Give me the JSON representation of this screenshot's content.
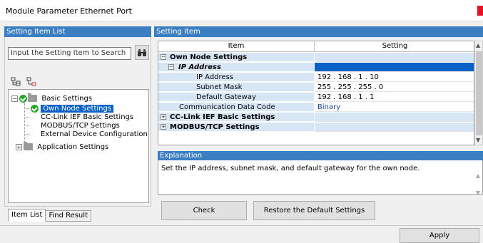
{
  "window": {
    "title": "Module Parameter Ethernet Port"
  },
  "left_panel": {
    "header": "Setting Item List",
    "search_placeholder": "Input the Setting Item to Search",
    "tree": [
      {
        "label": "Basic Settings"
      },
      {
        "label": "Own Node Settings"
      },
      {
        "label": "CC-Link IEF Basic Settings"
      },
      {
        "label": "MODBUS/TCP Settings"
      },
      {
        "label": "External Device Configuration"
      },
      {
        "label": "Application Settings"
      }
    ],
    "tabs": [
      "Item List",
      "Find Result"
    ]
  },
  "right_panel": {
    "header": "Setting Item",
    "columns": [
      "Item",
      "Setting"
    ],
    "rows": [
      {
        "item": "Own Node Settings",
        "setting": ""
      },
      {
        "item": "IP Address",
        "setting": ""
      },
      {
        "item": "IP Address",
        "setting": "192 . 168 .   1 .  10"
      },
      {
        "item": "Subnet Mask",
        "setting": "255 . 255 . 255 .   0"
      },
      {
        "item": "Default Gateway",
        "setting": "192 . 168 .   1 .   1"
      },
      {
        "item": "Communication Data Code",
        "setting": "Binary"
      },
      {
        "item": "CC-Link IEF Basic Settings",
        "setting": ""
      },
      {
        "item": "MODBUS/TCP Settings",
        "setting": ""
      }
    ]
  },
  "explanation": {
    "header": "Explanation",
    "text": "Set the IP address, subnet mask, and default gateway for the own node."
  },
  "buttons": {
    "check": "Check",
    "restore": "Restore the Default Settings",
    "apply": "Apply"
  },
  "colors": {
    "header_blue": "#3c7fc1",
    "selected_blue": "#0a62c7",
    "category_bg": "#d6e6f5"
  }
}
